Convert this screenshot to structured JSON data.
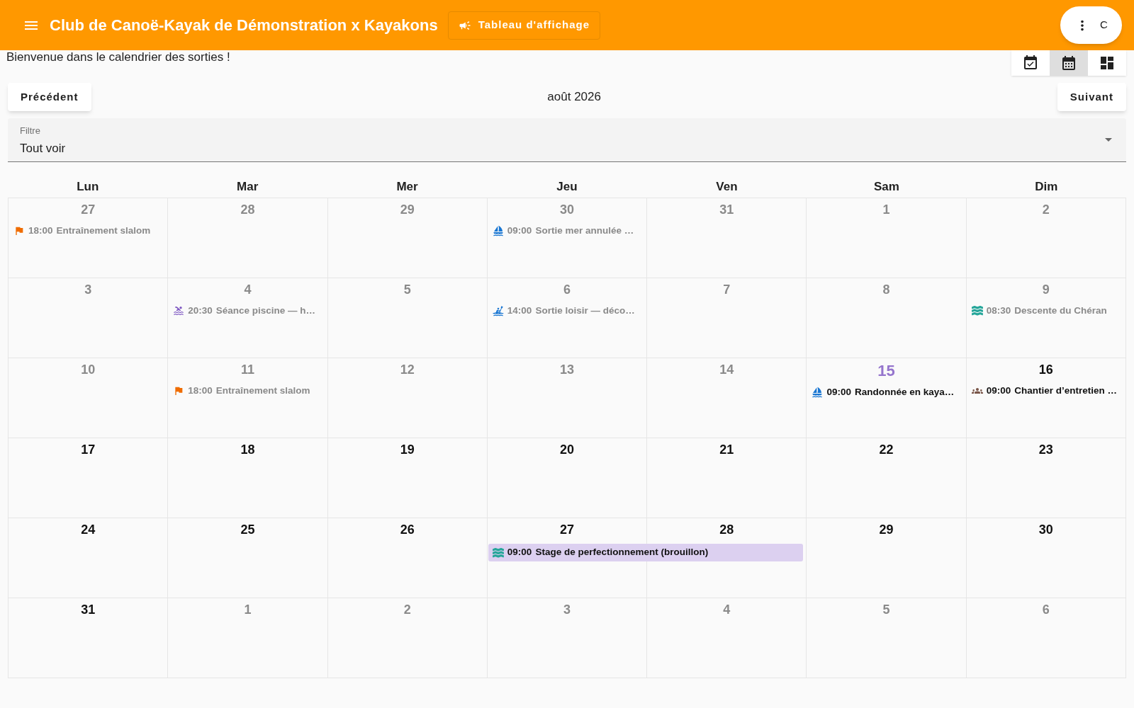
{
  "app_bar": {
    "title": "Club de Canoë-Kayak de Démonstration x Kayakons",
    "board_button": "Tableau d'affichage",
    "account_initial": "C"
  },
  "welcome": "Bienvenue dans le calendrier des sorties !",
  "view_toggle": [
    {
      "kind": "checklist",
      "selected": false
    },
    {
      "kind": "month",
      "selected": true
    },
    {
      "kind": "dashboard",
      "selected": false
    }
  ],
  "nav": {
    "previous": "Précédent",
    "month": "août 2026",
    "next": "Suivant"
  },
  "filter": {
    "label": "Filtre",
    "value": "Tout voir"
  },
  "weekdays": [
    "Lun",
    "Mar",
    "Mer",
    "Jeu",
    "Ven",
    "Sam",
    "Dim"
  ],
  "weeks": [
    {
      "days": [
        {
          "date": "27",
          "muted": true,
          "today": false,
          "events": [
            {
              "kind": "flag",
              "color": "#ef6c00",
              "time": "18:00",
              "title": "Entraînement slalom"
            }
          ]
        },
        {
          "date": "28",
          "muted": true,
          "today": false
        },
        {
          "date": "29",
          "muted": true,
          "today": false
        },
        {
          "date": "30",
          "muted": true,
          "today": false,
          "events": [
            {
              "kind": "sail",
              "color": "#1976d2",
              "time": "09:00",
              "title": "Sortie mer annulée …"
            }
          ]
        },
        {
          "date": "31",
          "muted": true,
          "today": false
        },
        {
          "date": "1",
          "muted": true,
          "today": false
        },
        {
          "date": "2",
          "muted": true,
          "today": false
        }
      ]
    },
    {
      "days": [
        {
          "date": "3",
          "muted": true,
          "today": false
        },
        {
          "date": "4",
          "muted": true,
          "today": false,
          "events": [
            {
              "kind": "pool",
              "color": "#7e57c2",
              "time": "20:30",
              "title": "Séance piscine — h…"
            }
          ]
        },
        {
          "date": "5",
          "muted": true,
          "today": false
        },
        {
          "date": "6",
          "muted": true,
          "today": false,
          "events": [
            {
              "kind": "kayak",
              "color": "#1976d2",
              "time": "14:00",
              "title": "Sortie loisir — déco…"
            }
          ]
        },
        {
          "date": "7",
          "muted": true,
          "today": false
        },
        {
          "date": "8",
          "muted": true,
          "today": false
        },
        {
          "date": "9",
          "muted": true,
          "today": false,
          "events": [
            {
              "kind": "waves",
              "color": "#26a69a",
              "time": "08:30",
              "title": "Descente du Chéran"
            }
          ]
        }
      ]
    },
    {
      "days": [
        {
          "date": "10",
          "muted": true,
          "today": false
        },
        {
          "date": "11",
          "muted": true,
          "today": false,
          "events": [
            {
              "kind": "flag",
              "color": "#ef6c00",
              "time": "18:00",
              "title": "Entraînement slalom"
            }
          ]
        },
        {
          "date": "12",
          "muted": true,
          "today": false
        },
        {
          "date": "13",
          "muted": true,
          "today": false
        },
        {
          "date": "14",
          "muted": true,
          "today": false
        },
        {
          "date": "15",
          "muted": false,
          "today": true,
          "events": [
            {
              "kind": "sail",
              "color": "#1976d2",
              "time": "09:00",
              "title": "Randonnée en kaya…"
            }
          ]
        },
        {
          "date": "16",
          "muted": false,
          "today": false,
          "events": [
            {
              "kind": "group",
              "color": "#795548",
              "time": "09:00",
              "title": "Chantier d’entretien …"
            }
          ]
        }
      ]
    },
    {
      "days": [
        {
          "date": "17",
          "muted": false,
          "today": false
        },
        {
          "date": "18",
          "muted": false,
          "today": false
        },
        {
          "date": "19",
          "muted": false,
          "today": false
        },
        {
          "date": "20",
          "muted": false,
          "today": false
        },
        {
          "date": "21",
          "muted": false,
          "today": false
        },
        {
          "date": "22",
          "muted": false,
          "today": false
        },
        {
          "date": "23",
          "muted": false,
          "today": false
        }
      ]
    },
    {
      "days": [
        {
          "date": "24",
          "muted": false,
          "today": false
        },
        {
          "date": "25",
          "muted": false,
          "today": false
        },
        {
          "date": "26",
          "muted": false,
          "today": false
        },
        {
          "date": "27",
          "muted": false,
          "today": false,
          "events": [
            {
              "kind": "waves",
              "color": "#26a69a",
              "time": "09:00",
              "title": "Stage de perfectionnement (brouillon)",
              "continues_next_day": true
            }
          ]
        },
        {
          "date": "28",
          "muted": false,
          "today": false
        },
        {
          "date": "29",
          "muted": false,
          "today": false
        },
        {
          "date": "30",
          "muted": false,
          "today": false
        }
      ]
    },
    {
      "days": [
        {
          "date": "31",
          "muted": false,
          "today": false
        },
        {
          "date": "1",
          "muted": true,
          "today": false
        },
        {
          "date": "2",
          "muted": true,
          "today": false
        },
        {
          "date": "3",
          "muted": true,
          "today": false
        },
        {
          "date": "4",
          "muted": true,
          "today": false
        },
        {
          "date": "5",
          "muted": true,
          "today": false
        },
        {
          "date": "6",
          "muted": true,
          "today": false
        }
      ]
    }
  ]
}
